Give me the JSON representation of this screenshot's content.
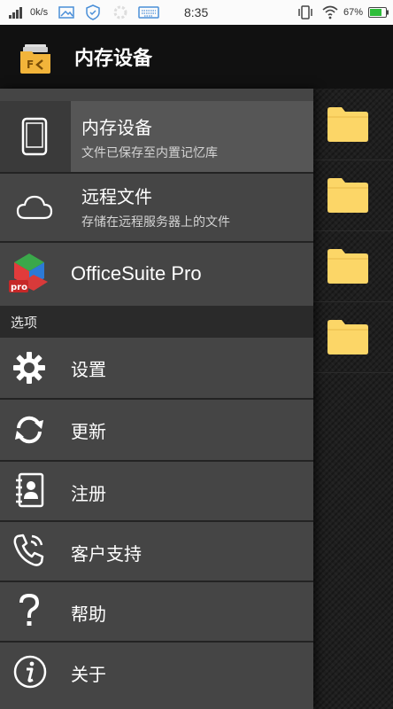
{
  "status_bar": {
    "speed": "0k/s",
    "time": "8:35",
    "battery": "67%"
  },
  "header": {
    "title": "内存设备"
  },
  "drawer": {
    "storage_items": [
      {
        "title": "内存设备",
        "subtitle": "文件已保存至内置记忆库",
        "icon": "phone-icon"
      },
      {
        "title": "远程文件",
        "subtitle": "存储在远程服务器上的文件",
        "icon": "cloud-icon"
      }
    ],
    "app_item": {
      "title": "OfficeSuite Pro",
      "icon": "officesuite-pro-icon"
    },
    "section_label": "选项",
    "options": [
      {
        "label": "设置",
        "icon": "gear-icon"
      },
      {
        "label": "更新",
        "icon": "refresh-icon"
      },
      {
        "label": "注册",
        "icon": "contact-book-icon"
      },
      {
        "label": "客户支持",
        "icon": "phone-support-icon"
      },
      {
        "label": "帮助",
        "icon": "question-icon"
      },
      {
        "label": "关于",
        "icon": "info-icon"
      }
    ]
  },
  "colors": {
    "drawer_bg": "#454545",
    "selected_bg": "#565656",
    "folder": "#fcd667",
    "header_bg": "#111111"
  }
}
